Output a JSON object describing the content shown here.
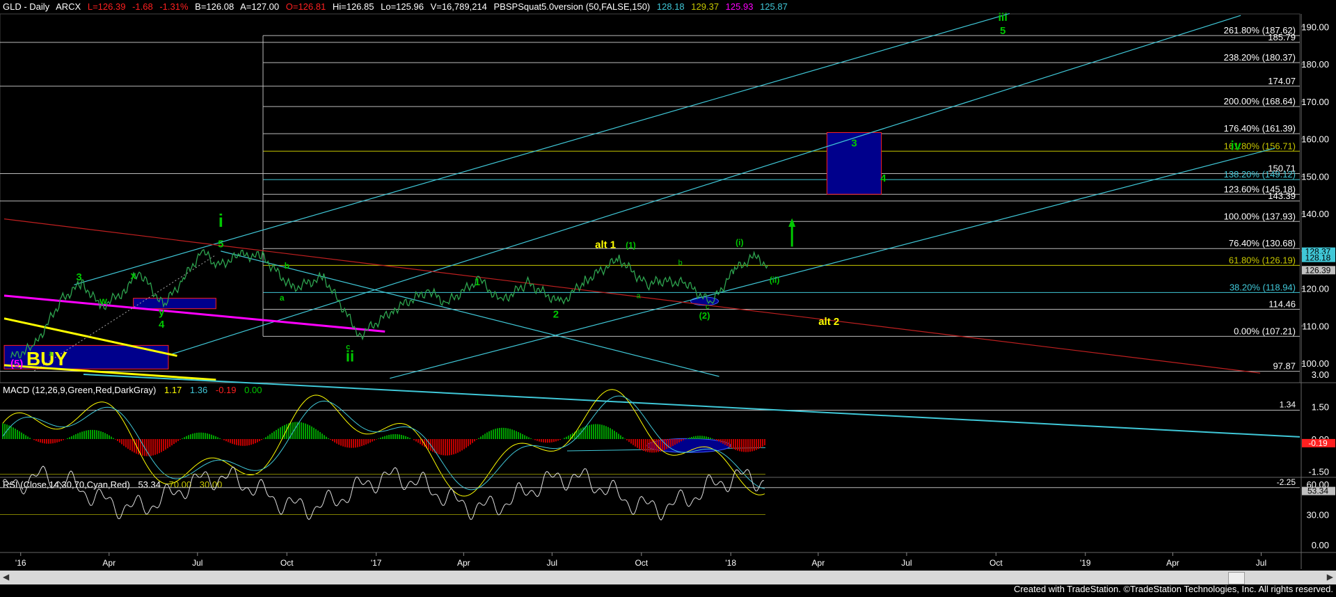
{
  "header": {
    "symbol": "GLD - Daily",
    "exchange": "ARCX",
    "last": "L=126.39",
    "change": "-1.68",
    "pct": "-1.31%",
    "bid": "B=126.08",
    "ask": "A=127.00",
    "open": "O=126.81",
    "high": "Hi=126.85",
    "low": "Lo=125.96",
    "volume": "V=16,789,214",
    "study": "PBSPSquat5.0version (50,FALSE,150)",
    "v1": "128.18",
    "v2": "129.37",
    "v3": "125.93",
    "v4": "125.87"
  },
  "colors": {
    "green": "#00c800",
    "red": "#ff2020",
    "yellow": "#ffff00",
    "cyan": "#40c8d8",
    "magenta": "#ff00ff",
    "olive": "#c8c800",
    "blue_box": "#00008c",
    "price": "#2ea44f"
  },
  "macd": {
    "title": "MACD (12,26,9,Green,Red,DarkGray)",
    "v1": "1.17",
    "v2": "1.36",
    "v3": "-0.19",
    "v4": "0.00",
    "ticks": [
      "3.00",
      "1.50",
      "0.00",
      "-1.50"
    ],
    "levels": [
      "1.34",
      "-2.25"
    ],
    "badge": "-0.19"
  },
  "rsi": {
    "title": "RSI (Close,14,30,70,Cyan,Red)",
    "v1": "53.34",
    "v2": "70.00",
    "v3": "30.00",
    "ticks": [
      "60.00",
      "30.00",
      "0.00"
    ],
    "badge": "53.34"
  },
  "footer": "Created with TradeStation. ©TradeStation Technologies, Inc. All rights reserved.",
  "chart_data": {
    "type": "line",
    "title": "GLD - Daily",
    "y_ticks": [
      190,
      180,
      170,
      160,
      150,
      140,
      130,
      120,
      110,
      100
    ],
    "ylim": [
      96,
      193
    ],
    "x_ticks": [
      "'16",
      "Apr",
      "Jul",
      "Oct",
      "'17",
      "Apr",
      "Jul",
      "Oct",
      "'18",
      "Apr",
      "Jul",
      "Oct",
      "'19",
      "Apr",
      "Jul"
    ],
    "price_badges": [
      "128.37",
      "128.18",
      "126.39"
    ],
    "fib_levels": [
      {
        "label": "261.80% (187.62)",
        "value": 187.62,
        "color": "#ffffff"
      },
      {
        "label": "185.79",
        "value": 185.79,
        "color": "#ffffff"
      },
      {
        "label": "238.20% (180.37)",
        "value": 180.37,
        "color": "#ffffff"
      },
      {
        "label": "174.07",
        "value": 174.07,
        "color": "#ffffff"
      },
      {
        "label": "200.00% (168.64)",
        "value": 168.64,
        "color": "#ffffff"
      },
      {
        "label": "176.40% (161.39)",
        "value": 161.39,
        "color": "#ffffff"
      },
      {
        "label": "161.80% (156.71)",
        "value": 156.71,
        "color": "#c8c800"
      },
      {
        "label": "150.71",
        "value": 150.71,
        "color": "#ffffff"
      },
      {
        "label": "138.20% (149.12)",
        "value": 149.12,
        "color": "#40c8d8"
      },
      {
        "label": "123.60% (145.18)",
        "value": 145.18,
        "color": "#ffffff"
      },
      {
        "label": "143.39",
        "value": 143.39,
        "color": "#ffffff"
      },
      {
        "label": "100.00% (137.93)",
        "value": 137.93,
        "color": "#ffffff"
      },
      {
        "label": "76.40% (130.68)",
        "value": 130.68,
        "color": "#ffffff"
      },
      {
        "label": "61.80% (126.19)",
        "value": 126.19,
        "color": "#c8c800"
      },
      {
        "label": "38.20% (118.94)",
        "value": 118.94,
        "color": "#40c8d8"
      },
      {
        "label": "114.46",
        "value": 114.46,
        "color": "#ffffff"
      },
      {
        "label": "0.00% (107.21)",
        "value": 107.21,
        "color": "#ffffff"
      },
      {
        "label": "97.87",
        "value": 97.87,
        "color": "#ffffff"
      }
    ],
    "series": [
      {
        "name": "GLD",
        "x": [
          "2015-12-22",
          "2016-01-15",
          "2016-02-12",
          "2016-03-04",
          "2016-03-24",
          "2016-04-15",
          "2016-05-02",
          "2016-05-27",
          "2016-06-15",
          "2016-07-06",
          "2016-07-21",
          "2016-08-15",
          "2016-09-06",
          "2016-10-07",
          "2016-11-08",
          "2016-12-15",
          "2017-01-20",
          "2017-02-24",
          "2017-03-14",
          "2017-04-17",
          "2017-05-09",
          "2017-06-06",
          "2017-07-10",
          "2017-08-04",
          "2017-09-08",
          "2017-10-06",
          "2017-10-20",
          "2017-11-15",
          "2017-12-12",
          "2018-01-05",
          "2018-01-25",
          "2018-02-08"
        ],
        "values": [
          101.5,
          104.5,
          117.0,
          121.5,
          115.0,
          119.0,
          124.5,
          115.5,
          122.0,
          130.0,
          126.0,
          129.0,
          128.5,
          120.0,
          123.0,
          107.5,
          114.5,
          119.5,
          116.0,
          122.5,
          116.5,
          121.5,
          116.0,
          122.0,
          128.0,
          121.0,
          122.0,
          121.5,
          116.0,
          125.0,
          128.5,
          126.2
        ]
      }
    ],
    "annotations": [
      {
        "text": "i",
        "color": "#00c800"
      },
      {
        "text": "5",
        "color": "#00c800"
      },
      {
        "text": "3",
        "color": "#00c800"
      },
      {
        "text": "x",
        "color": "#00c800"
      },
      {
        "text": "w",
        "color": "#00c800"
      },
      {
        "text": "y",
        "color": "#00c800"
      },
      {
        "text": "4",
        "color": "#00c800"
      },
      {
        "text": "BUY",
        "color": "#ffff00"
      },
      {
        "text": "(5)",
        "color": "#ff00ff"
      },
      {
        "text": "ii",
        "color": "#00c800"
      },
      {
        "text": "c",
        "color": "#00c800"
      },
      {
        "text": "a",
        "color": "#00c800"
      },
      {
        "text": "b",
        "color": "#00c800"
      },
      {
        "text": "1",
        "color": "#00c800"
      },
      {
        "text": "2",
        "color": "#00c800"
      },
      {
        "text": "alt 1",
        "color": "#ffff00"
      },
      {
        "text": "(1)",
        "color": "#00c800"
      },
      {
        "text": "(2)",
        "color": "#00c800"
      },
      {
        "text": "(i)",
        "color": "#00c800"
      },
      {
        "text": "(ii)",
        "color": "#00c800"
      },
      {
        "text": "alt 2",
        "color": "#ffff00"
      },
      {
        "text": "3",
        "color": "#00c800"
      },
      {
        "text": "4",
        "color": "#00c800"
      },
      {
        "text": "iv",
        "color": "#00c800"
      },
      {
        "text": "iii",
        "color": "#00c800"
      },
      {
        "text": "5",
        "color": "#00c800"
      }
    ]
  }
}
